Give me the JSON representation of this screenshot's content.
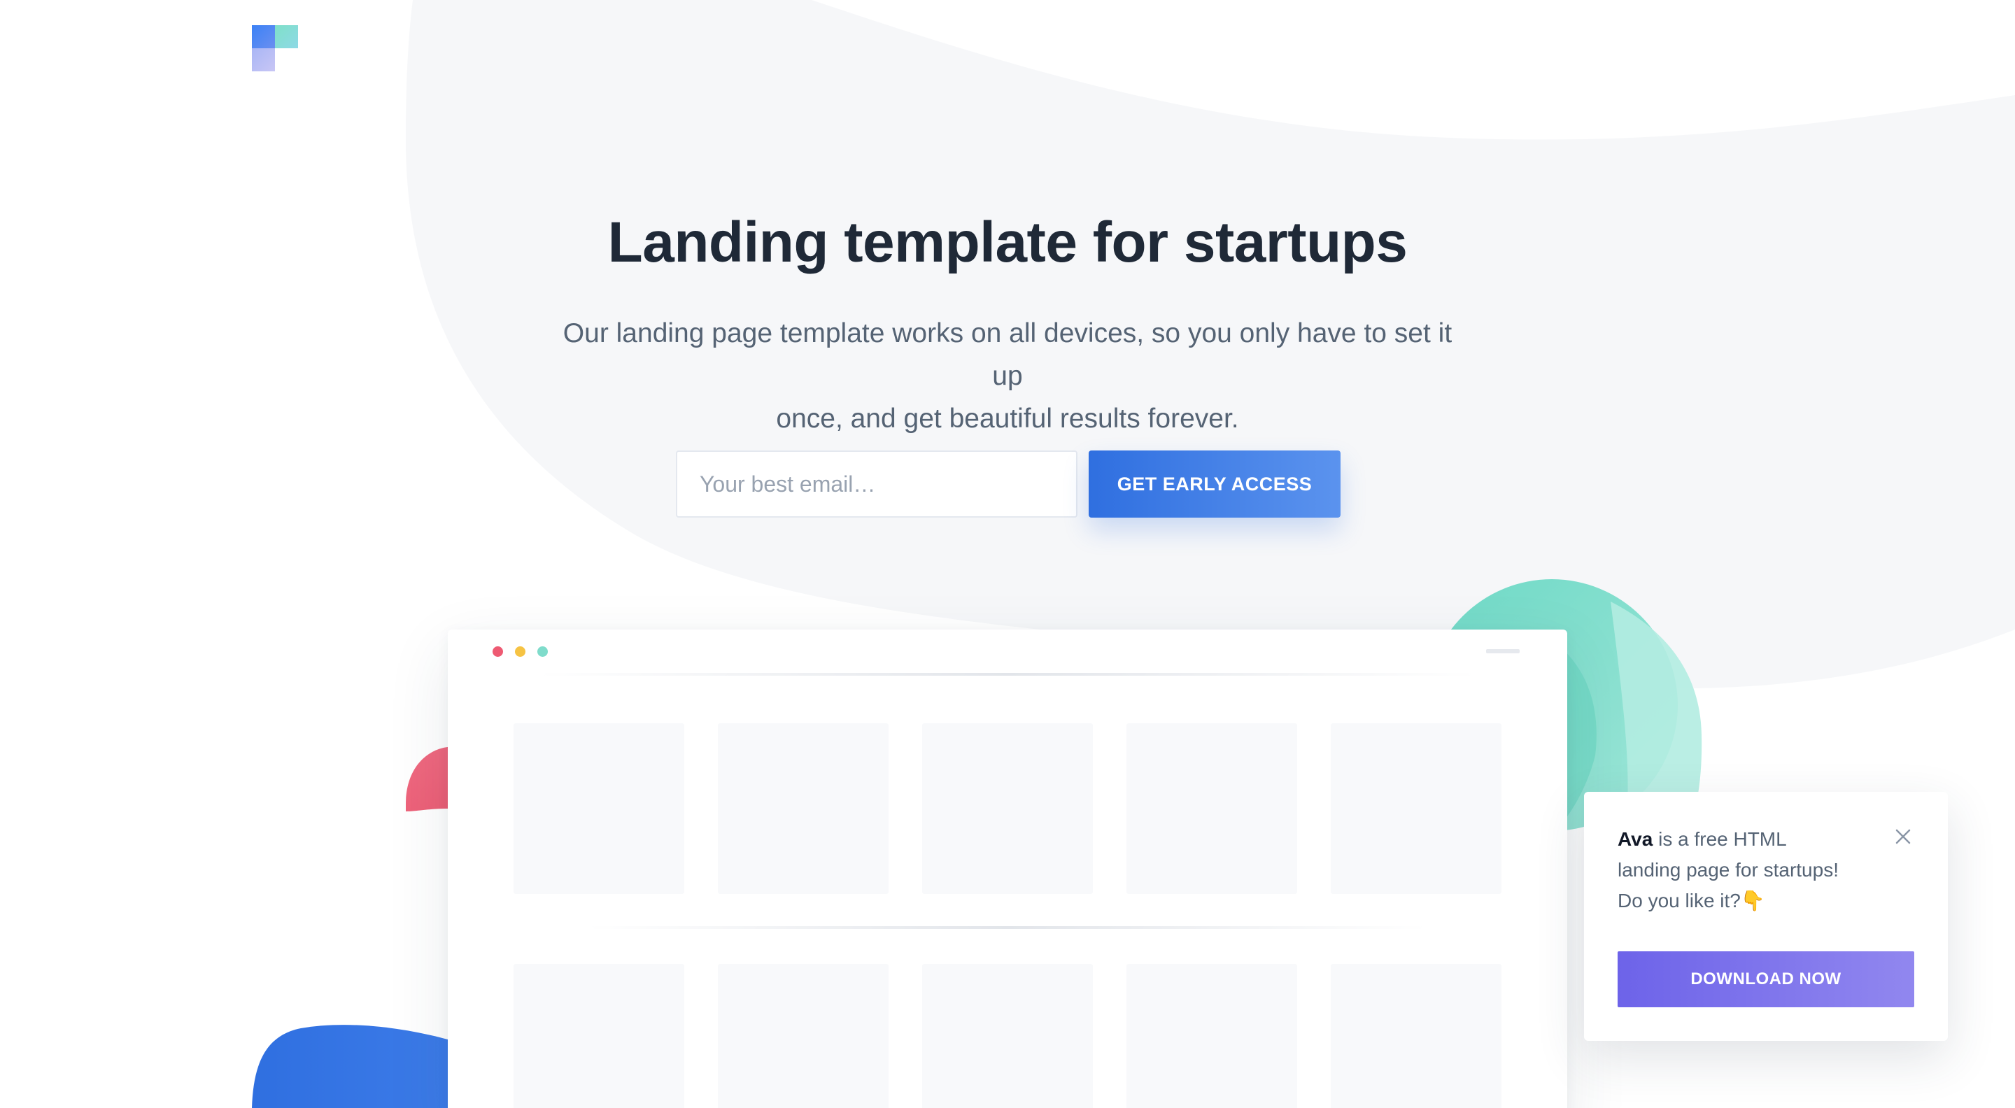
{
  "colors": {
    "background_blob": "#f6f7f9",
    "primary": "#2f6fe0",
    "title": "#1f2937",
    "body_text": "#556374",
    "accent_purple": "#6d63e9",
    "accent_teal": "#7fdccb",
    "accent_pink": "#ee5a72"
  },
  "logo": {
    "icon": "squares-logo-icon"
  },
  "hero": {
    "title": "Landing template for startups",
    "subtitle_line1": "Our landing page template works on all devices, so you only have to set it up",
    "subtitle_line2": "once, and get beautiful results forever.",
    "email_placeholder": "Your best email…",
    "cta_label": "GET EARLY ACCESS"
  },
  "mockup": {
    "window_dots": [
      "red",
      "yellow",
      "green"
    ],
    "tile_rows": 2,
    "tiles_per_row": 5
  },
  "popup": {
    "brand": "Ava",
    "text_part1": " is a free HTML",
    "text_part2": "landing page for startups!",
    "text_part3": "Do you like it?",
    "emoji": "👇",
    "close_icon": "close-icon",
    "button_label": "DOWNLOAD NOW"
  }
}
